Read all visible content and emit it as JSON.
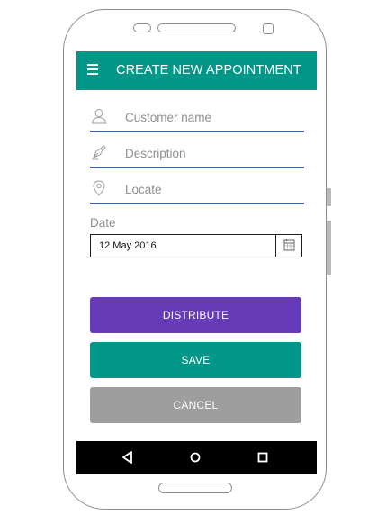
{
  "app": {
    "title": "CREATE NEW APPOINTMENT",
    "menu_icon": "hamburger-menu-icon",
    "accent_color": "#009688"
  },
  "form": {
    "customer_name": {
      "icon": "person-icon",
      "placeholder": "Customer name",
      "value": ""
    },
    "description": {
      "icon": "pen-icon",
      "placeholder": "Description",
      "value": ""
    },
    "locate": {
      "icon": "map-pin-icon",
      "placeholder": "Locate",
      "value": ""
    },
    "date": {
      "label": "Date",
      "value": "12 May 2016",
      "icon": "calendar-icon"
    }
  },
  "buttons": {
    "distribute": {
      "label": "DISTRIBUTE",
      "color": "#673ab7"
    },
    "save": {
      "label": "SAVE",
      "color": "#009688"
    },
    "cancel": {
      "label": "CANCEL",
      "color": "#9e9e9e"
    }
  },
  "navigation": {
    "back_icon": "back-triangle-icon",
    "home_icon": "home-circle-icon",
    "recents_icon": "recents-square-icon"
  }
}
